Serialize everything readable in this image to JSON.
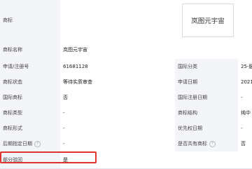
{
  "rows": [
    {
      "label": "商标",
      "value": "",
      "logo_text": "岚图元宇宙"
    },
    {
      "label": "商标名称",
      "value": "岚图元宇宙"
    },
    {
      "label": "申请/注册号",
      "value": "61681128",
      "label2": "国际分类",
      "value2": "25-服"
    },
    {
      "label": "商标状态",
      "value": "等待实质审查",
      "label2": "申请日期",
      "value2": "2021"
    },
    {
      "label": "国际商标",
      "value": "否",
      "label2": "国际注册日期",
      "value2": "-"
    },
    {
      "label": "商标类型",
      "value": "-",
      "label2": "商标结构",
      "value2": "纯中"
    },
    {
      "label": "商标形式",
      "value": "-",
      "label2": "优先权日期",
      "value2": "-"
    },
    {
      "label": "后期指定日期",
      "value": "-",
      "label2": "是否共有商标",
      "value2": "否"
    },
    {
      "label": "部分驳回",
      "value": "是"
    }
  ],
  "icons": {
    "help": "help-circle-icon"
  },
  "highlight_color": "#e0342e"
}
